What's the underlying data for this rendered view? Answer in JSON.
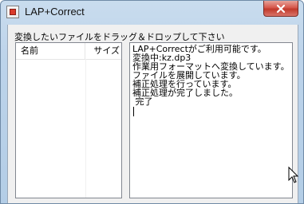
{
  "window": {
    "title": "LAP+Correct"
  },
  "instruction": "変換したいファイルをドラッグ＆ドロップして下さい",
  "file_list": {
    "columns": [
      {
        "label": "名前"
      },
      {
        "label": "サイズ"
      }
    ]
  },
  "log": {
    "lines": [
      "LAP+Correctがご利用可能です。",
      "変換中:kz.dp3",
      "作業用フォーマットへ変換しています。",
      "ファイルを展開しています。",
      "補正処理を行っています。",
      "補正処理が完了しました。",
      " 完了"
    ]
  },
  "colors": {
    "title_gradient_top": "#c9dcee",
    "close_button": "#c0392b",
    "client_bg": "#f0f0f0"
  },
  "icons": {
    "app": "app-icon",
    "close": "close-icon",
    "cursor": "arrow-cursor-icon"
  }
}
